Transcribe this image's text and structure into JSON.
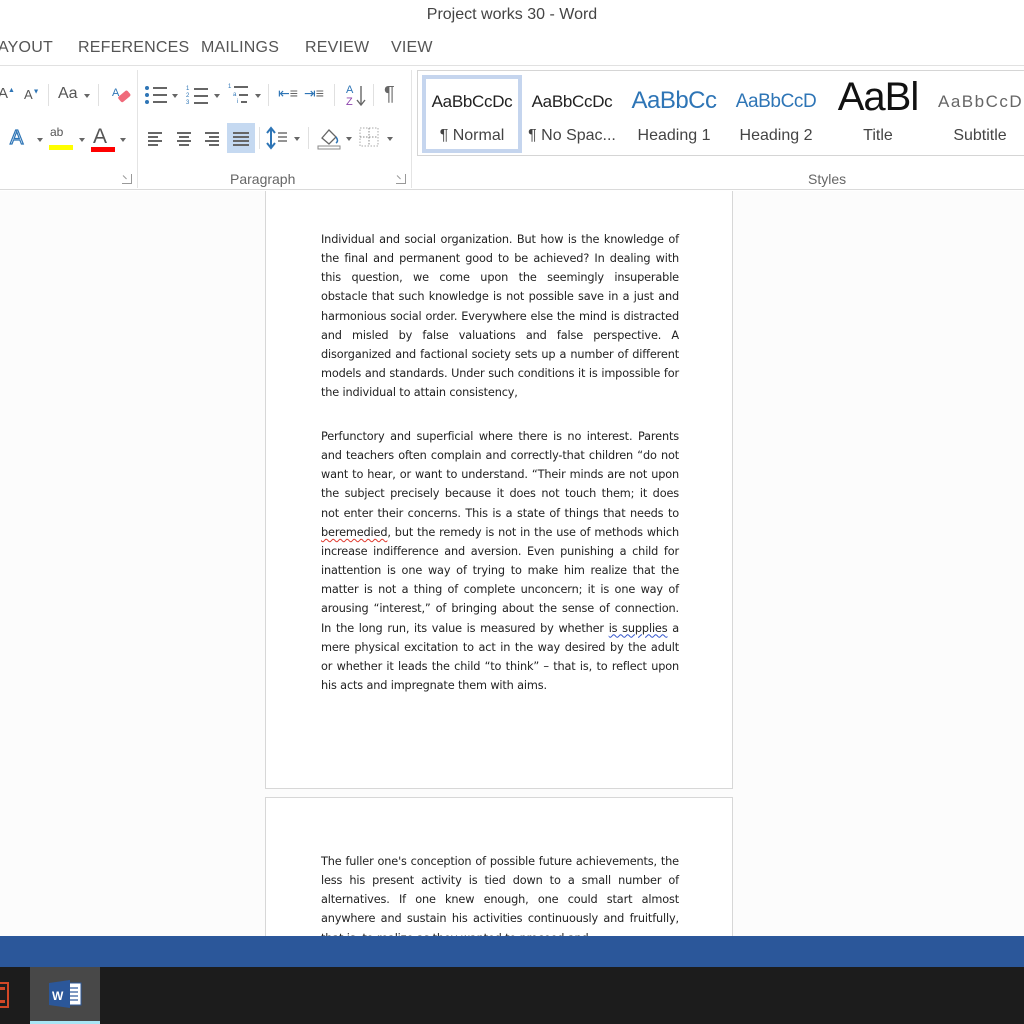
{
  "window": {
    "title": "Project works 30 - Word"
  },
  "ribbon_tabs": [
    {
      "label": "AYOUT"
    },
    {
      "label": "REFERENCES"
    },
    {
      "label": "MAILINGS"
    },
    {
      "label": "REVIEW"
    },
    {
      "label": "VIEW"
    }
  ],
  "font_group": {
    "grow_font": "A",
    "shrink_font": "A",
    "change_case": "Aa",
    "text_effects": "A",
    "highlight_label": "ab",
    "font_color_label": "A",
    "highlight_color": "#ffff00",
    "font_color": "#ff0000"
  },
  "paragraph_group": {
    "label": "Paragraph",
    "sort_label": "A Z",
    "pilcrow": "¶",
    "active_alignment": "justify"
  },
  "styles_group": {
    "label": "Styles",
    "items": [
      {
        "preview": "AaBbCcDc",
        "name": "¶ Normal",
        "selected": true
      },
      {
        "preview": "AaBbCcDc",
        "name": "¶ No Spac..."
      },
      {
        "preview": "AaBbCc",
        "name": "Heading 1"
      },
      {
        "preview": "AaBbCcD",
        "name": "Heading 2"
      },
      {
        "preview": "AaBl",
        "name": "Title"
      },
      {
        "preview": "AaBbCcD",
        "name": "Subtitle"
      }
    ]
  },
  "document": {
    "page1": {
      "para1": "Individual and social organization. But how is the knowledge of the final and permanent good to be achieved? In dealing with this question, we come upon the seemingly insuperable obstacle that such knowledge is not possible save in a just and harmonious social order. Everywhere else the mind is distracted and misled by false valuations and false perspective. A disorganized and factional society sets up a number of different models and standards. Under such conditions it is impossible for the individual to attain consistency,",
      "para2_a": "Perfunctory and superficial where there is no interest. Parents and teachers often complain and correctly-that children “do not want to hear, or want to understand. “Their minds are not upon the subject precisely because it does not touch them; it does not enter their concerns. This is a state of things that needs to ",
      "para2_spell": "beremedied",
      "para2_b": ", but the remedy is not in the use of methods which increase indifference and aversion. Even punishing a child for inattention is one way of trying to make him realize that the matter is not a thing of complete unconcern; it is one way of arousing “interest,” of bringing about the sense of connection. In the long run, its value is measured by whether ",
      "para2_grammar": "is supplies",
      "para2_c": " a mere physical excitation to act in the way desired by the adult or whether it leads the child “to think” – that is, to reflect upon his acts and impregnate them with aims."
    },
    "page2": {
      "para1": "The fuller one's conception of possible future achievements, the less his present activity is tied down to a small number of alternatives. If one knew enough, one could start almost anywhere and sustain his activities continuously and fruitfully, that is, to realize as they wanted to proceed and"
    }
  },
  "taskbar": {
    "items": [
      {
        "name": "PowerPoint",
        "glyph": "P"
      },
      {
        "name": "Word",
        "glyph": "W",
        "active": true
      }
    ]
  }
}
